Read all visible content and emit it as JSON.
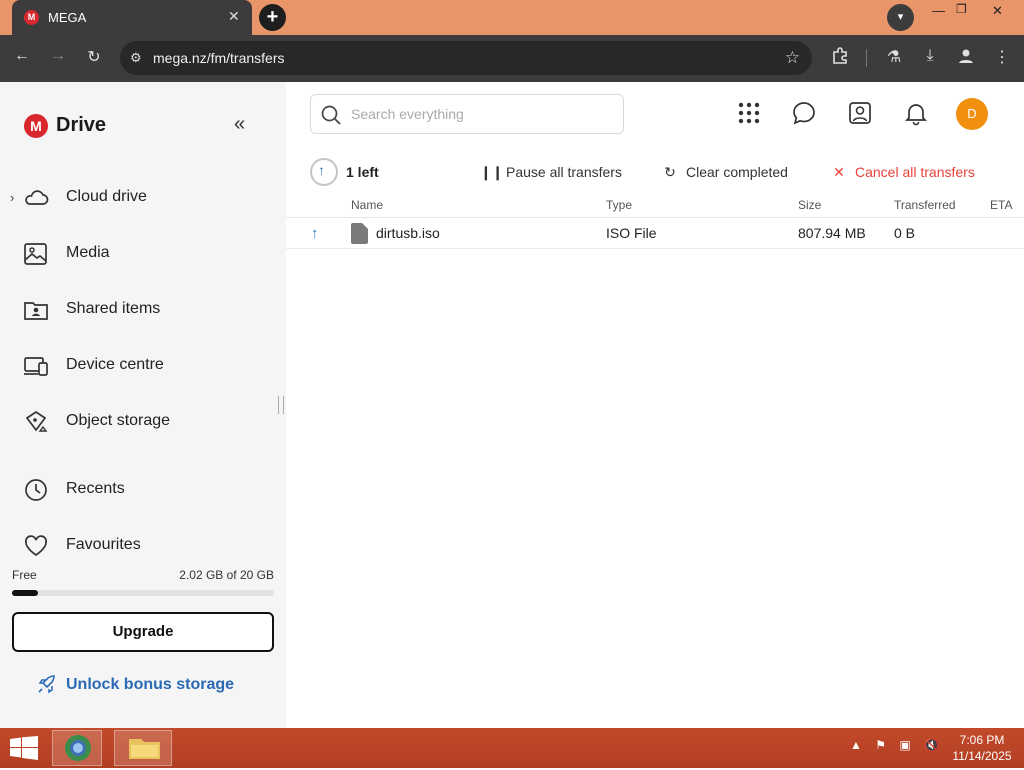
{
  "browser": {
    "tab_title": "MEGA",
    "tab_favicon": "M",
    "url": "mega.nz/fm/transfers"
  },
  "sidebar": {
    "logo_letter": "M",
    "brand": "Drive",
    "items": [
      {
        "label": "Cloud drive",
        "icon": "cloud-icon"
      },
      {
        "label": "Media",
        "icon": "image-icon"
      },
      {
        "label": "Shared items",
        "icon": "shared-folder-icon"
      },
      {
        "label": "Device centre",
        "icon": "devices-icon"
      },
      {
        "label": "Object storage",
        "icon": "bucket-icon"
      },
      {
        "label": "Recents",
        "icon": "clock-icon"
      },
      {
        "label": "Favourites",
        "icon": "heart-icon"
      }
    ],
    "storage": {
      "free_label": "Free",
      "used_text": "2.02 GB of 20 GB",
      "used_fraction": 0.101
    },
    "upgrade_label": "Upgrade",
    "bonus_label": "Unlock bonus storage"
  },
  "header": {
    "search_placeholder": "Search everything",
    "avatar_initial": "D"
  },
  "transfers": {
    "left_text": "1 left",
    "pause_label": "Pause all transfers",
    "clear_label": "Clear completed",
    "cancel_label": "Cancel all transfers",
    "columns": {
      "name": "Name",
      "type": "Type",
      "size": "Size",
      "transferred": "Transferred",
      "eta": "ETA"
    },
    "rows": [
      {
        "name": "dirtusb.iso",
        "type": "ISO File",
        "size": "807.94 MB",
        "transferred": "0 B",
        "eta": ""
      }
    ]
  },
  "taskbar": {
    "time": "7:06 PM",
    "date": "11/14/2025"
  },
  "colors": {
    "mega_red": "#d9272e",
    "accent_blue": "#2a7fc4",
    "cancel_red": "#e8413a",
    "avatar_orange": "#f0900e"
  }
}
